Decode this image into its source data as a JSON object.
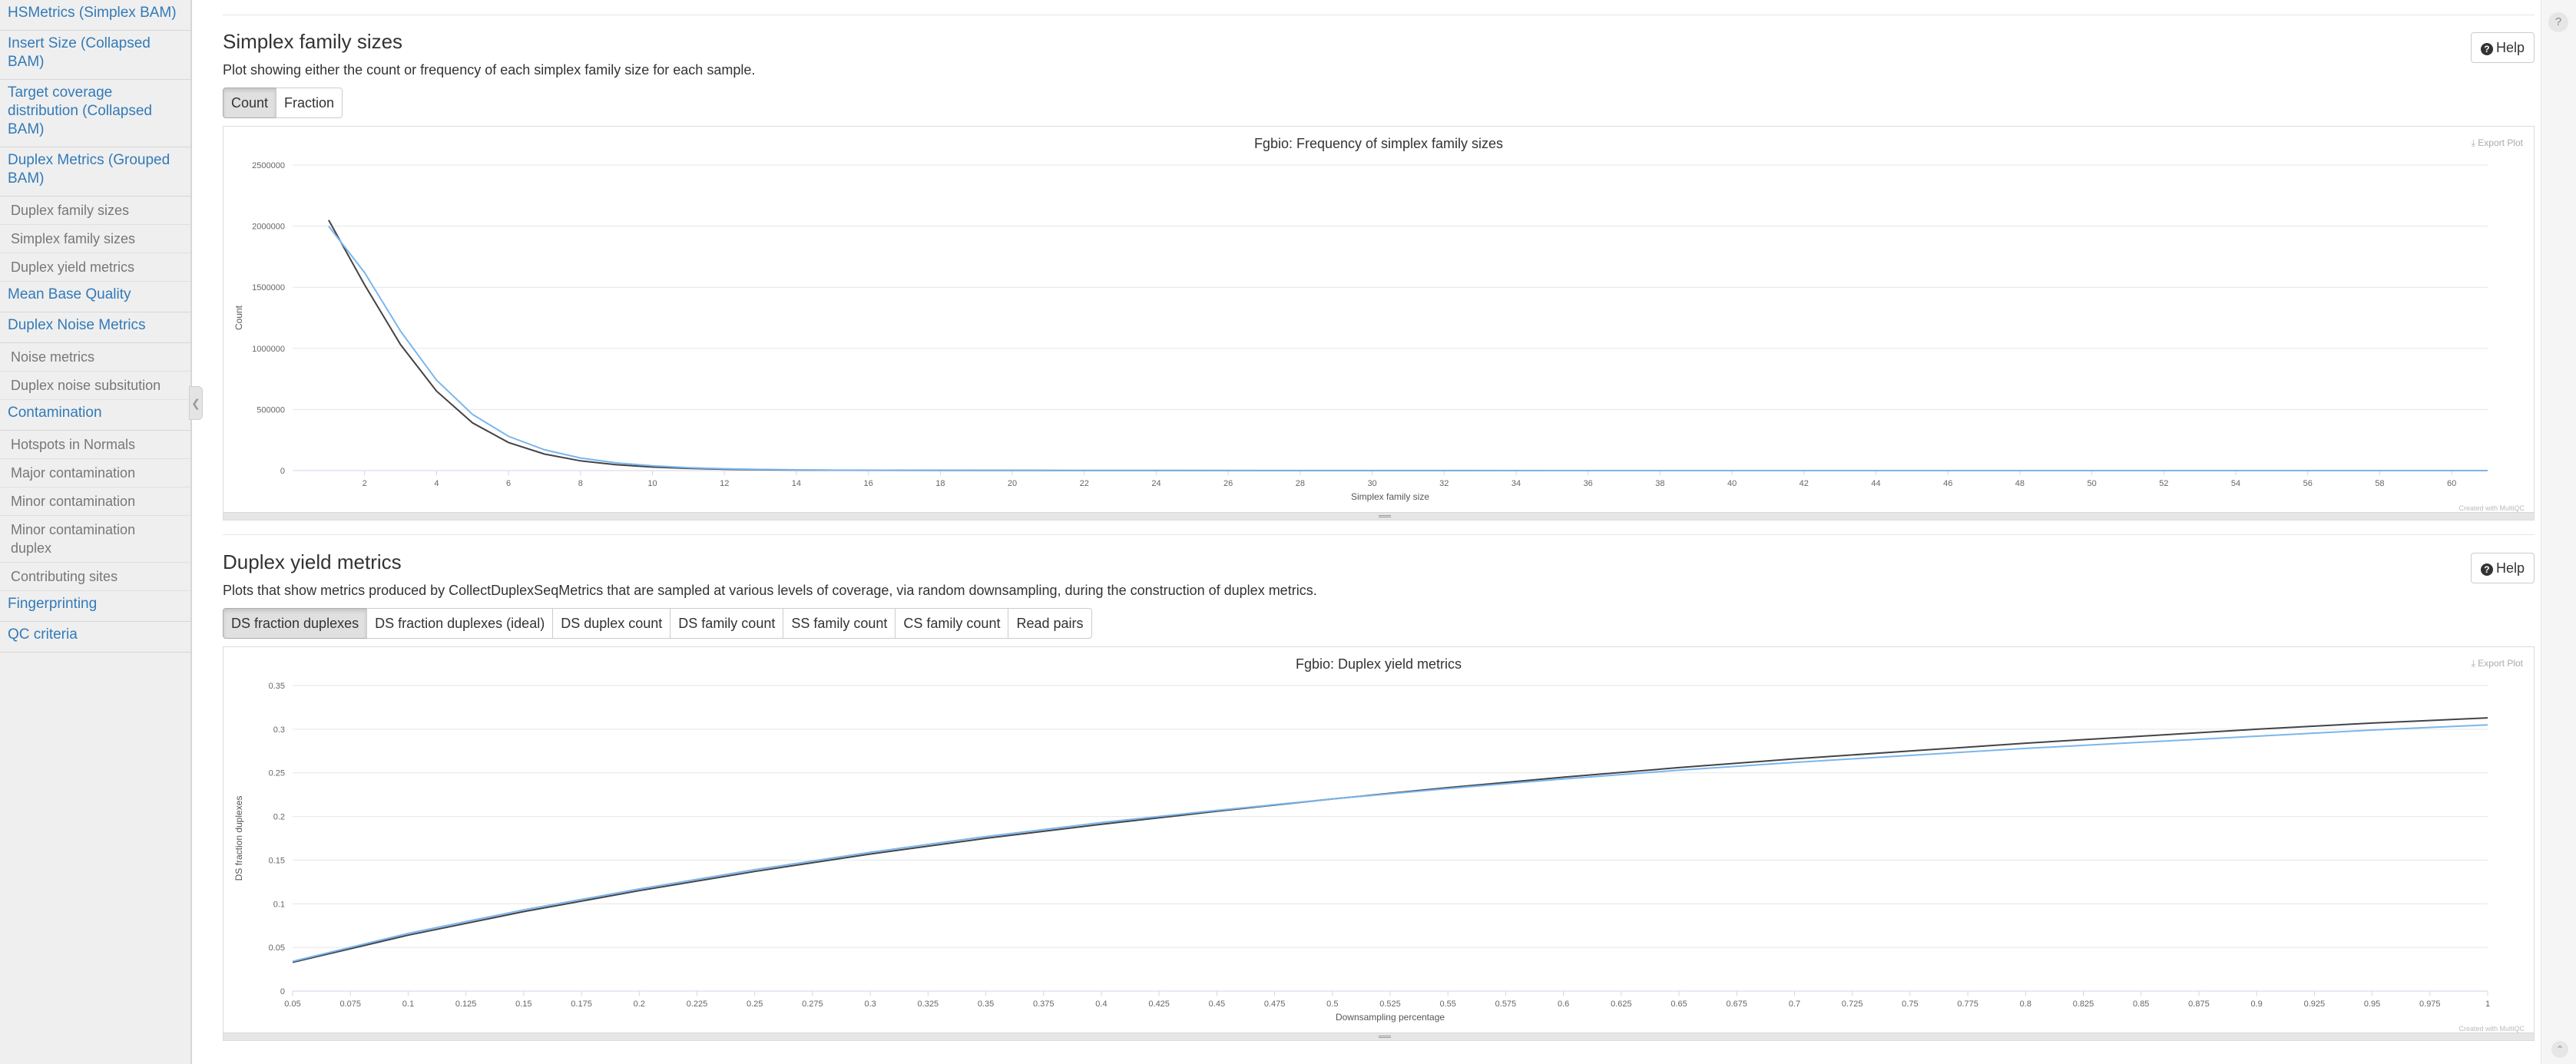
{
  "sidebar": {
    "items": [
      {
        "label": "HSMetrics (Simplex BAM)",
        "type": "top"
      },
      {
        "label": "Insert Size (Collapsed BAM)",
        "type": "top"
      },
      {
        "label": "Target coverage distribution (Collapsed BAM)",
        "type": "top"
      },
      {
        "label": "Duplex Metrics (Grouped BAM)",
        "type": "top"
      },
      {
        "label": "Duplex family sizes",
        "type": "sub"
      },
      {
        "label": "Simplex family sizes",
        "type": "sub"
      },
      {
        "label": "Duplex yield metrics",
        "type": "sub"
      },
      {
        "label": "Mean Base Quality",
        "type": "top"
      },
      {
        "label": "Duplex Noise Metrics",
        "type": "top"
      },
      {
        "label": "Noise metrics",
        "type": "sub"
      },
      {
        "label": "Duplex noise subsitution",
        "type": "sub"
      },
      {
        "label": "Contamination",
        "type": "top"
      },
      {
        "label": "Hotspots in Normals",
        "type": "sub"
      },
      {
        "label": "Major contamination",
        "type": "sub"
      },
      {
        "label": "Minor contamination",
        "type": "sub"
      },
      {
        "label": "Minor contamination duplex",
        "type": "sub"
      },
      {
        "label": "Contributing sites",
        "type": "sub"
      },
      {
        "label": "Fingerprinting",
        "type": "top"
      },
      {
        "label": "QC criteria",
        "type": "top"
      }
    ],
    "collapse_icon": "chevron-left-icon"
  },
  "right_strip": {
    "top_icon": "question-circle-icon",
    "bottom_icon": "chevron-up-icon"
  },
  "simplex": {
    "title": "Simplex family sizes",
    "description": "Plot showing either the count or frequency of each simplex family size for each sample.",
    "help_label": "Help",
    "toggle": [
      "Count",
      "Fraction"
    ],
    "active_toggle": "Count",
    "export_label": "Export Plot",
    "credit": "Created with MultiQC"
  },
  "yield": {
    "title": "Duplex yield metrics",
    "description": "Plots that show metrics produced by CollectDuplexSeqMetrics that are sampled at various levels of coverage, via random downsampling, during the construction of duplex metrics.",
    "help_label": "Help",
    "toggle": [
      "DS fraction duplexes",
      "DS fraction duplexes (ideal)",
      "DS duplex count",
      "DS family count",
      "SS family count",
      "CS family count",
      "Read pairs"
    ],
    "active_toggle": "DS fraction duplexes",
    "export_label": "Export Plot",
    "credit": "Created with MultiQC"
  },
  "colors": {
    "series_dark": "#434348",
    "series_blue": "#7cb5ec",
    "link": "#337ab7"
  },
  "chart_data": [
    {
      "type": "line",
      "title": "Fgbio: Frequency of simplex family sizes",
      "xlabel": "Simplex family size",
      "ylabel": "Count",
      "xlim": [
        0,
        61
      ],
      "ylim": [
        0,
        2500000
      ],
      "xticks": [
        2,
        4,
        6,
        8,
        10,
        12,
        14,
        16,
        18,
        20,
        22,
        24,
        26,
        28,
        30,
        32,
        34,
        36,
        38,
        40,
        42,
        44,
        46,
        48,
        50,
        52,
        54,
        56,
        58,
        60
      ],
      "yticks": [
        0,
        500000,
        1000000,
        1500000,
        2000000,
        2500000
      ],
      "grid": true,
      "series": [
        {
          "color": "#434348",
          "x": [
            1,
            2,
            3,
            4,
            5,
            6,
            7,
            8,
            9,
            10,
            11,
            12,
            13,
            14,
            15,
            20,
            30,
            40,
            50,
            60,
            61
          ],
          "values": [
            2050000,
            1520000,
            1030000,
            650000,
            390000,
            230000,
            135000,
            80000,
            48000,
            29000,
            18000,
            11000,
            7000,
            4500,
            3000,
            1000,
            300,
            100,
            40,
            10,
            5
          ]
        },
        {
          "color": "#7cb5ec",
          "x": [
            1,
            2,
            3,
            4,
            5,
            6,
            7,
            8,
            9,
            10,
            11,
            12,
            13,
            14,
            15,
            20,
            30,
            40,
            50,
            60,
            61
          ],
          "values": [
            2000000,
            1620000,
            1140000,
            740000,
            460000,
            280000,
            170000,
            103000,
            63000,
            39000,
            24000,
            15000,
            9500,
            6000,
            4000,
            1300,
            400,
            150,
            60,
            20,
            10
          ]
        }
      ]
    },
    {
      "type": "line",
      "title": "Fgbio: Duplex yield metrics",
      "xlabel": "Downsampling percentage",
      "ylabel": "DS fraction duplexes",
      "xlim": [
        0.05,
        1
      ],
      "ylim": [
        0,
        0.35
      ],
      "xticks": [
        "0.05",
        "0.075",
        "0.1",
        "0.125",
        "0.15",
        "0.175",
        "0.2",
        "0.225",
        "0.25",
        "0.275",
        "0.3",
        "0.325",
        "0.35",
        "0.375",
        "0.4",
        "0.425",
        "0.45",
        "0.475",
        "0.5",
        "0.525",
        "0.55",
        "0.575",
        "0.6",
        "0.625",
        "0.65",
        "0.675",
        "0.7",
        "0.725",
        "0.75",
        "0.775",
        "0.8",
        "0.825",
        "0.85",
        "0.875",
        "0.9",
        "0.925",
        "0.95",
        "0.975",
        "1"
      ],
      "yticks": [
        "0",
        "0.05",
        "0.1",
        "0.15",
        "0.2",
        "0.25",
        "0.3",
        "0.35"
      ],
      "grid": true,
      "series": [
        {
          "color": "#434348",
          "x": [
            0.05,
            0.1,
            0.15,
            0.2,
            0.25,
            0.3,
            0.35,
            0.4,
            0.45,
            0.5,
            0.55,
            0.6,
            0.65,
            0.7,
            0.75,
            0.8,
            0.85,
            0.9,
            0.95,
            1
          ],
          "values": [
            0.033,
            0.064,
            0.091,
            0.115,
            0.137,
            0.157,
            0.175,
            0.191,
            0.206,
            0.22,
            0.233,
            0.245,
            0.256,
            0.266,
            0.275,
            0.284,
            0.292,
            0.3,
            0.307,
            0.313
          ]
        },
        {
          "color": "#7cb5ec",
          "x": [
            0.05,
            0.1,
            0.15,
            0.2,
            0.25,
            0.3,
            0.35,
            0.4,
            0.45,
            0.5,
            0.55,
            0.6,
            0.65,
            0.7,
            0.75,
            0.8,
            0.85,
            0.9,
            0.95,
            1
          ],
          "values": [
            0.034,
            0.066,
            0.093,
            0.117,
            0.139,
            0.159,
            0.177,
            0.193,
            0.207,
            0.22,
            0.232,
            0.243,
            0.253,
            0.262,
            0.27,
            0.278,
            0.285,
            0.292,
            0.299,
            0.305
          ]
        }
      ]
    }
  ]
}
